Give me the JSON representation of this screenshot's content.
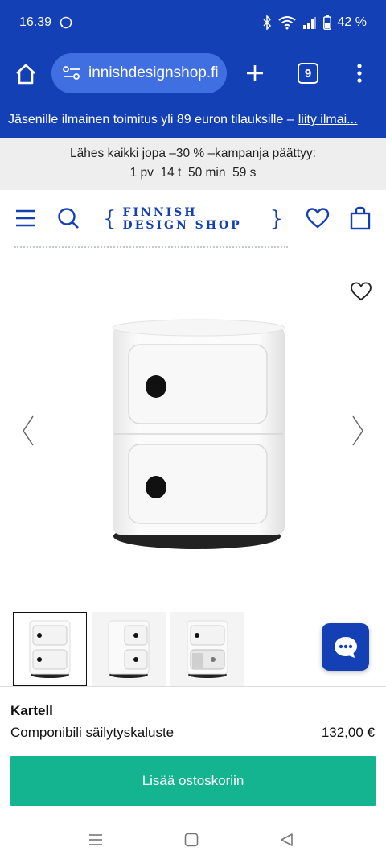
{
  "status_bar": {
    "time": "16.39",
    "battery": "42 %"
  },
  "browser": {
    "url": "innishdesignshop.fi",
    "tab_count": "9"
  },
  "promo": {
    "text": "Jäsenille ilmainen toimitus yli 89 euron tilauksille –",
    "link": "liity ilmai..."
  },
  "campaign": {
    "line1": "Lähes kaikki jopa –30 % –kampanja päättyy:",
    "line2": "1 pv  14 t  50 min  59 s"
  },
  "header": {
    "logo_text": "FINNISH DESIGN SHOP"
  },
  "product": {
    "brand": "Kartell",
    "name": "Componibili säilytyskaluste",
    "price": "132,00 €",
    "add_to_cart": "Lisää ostoskoriin"
  },
  "colors": {
    "brand_blue": "#1340b4",
    "accent_green": "#13b48f"
  }
}
